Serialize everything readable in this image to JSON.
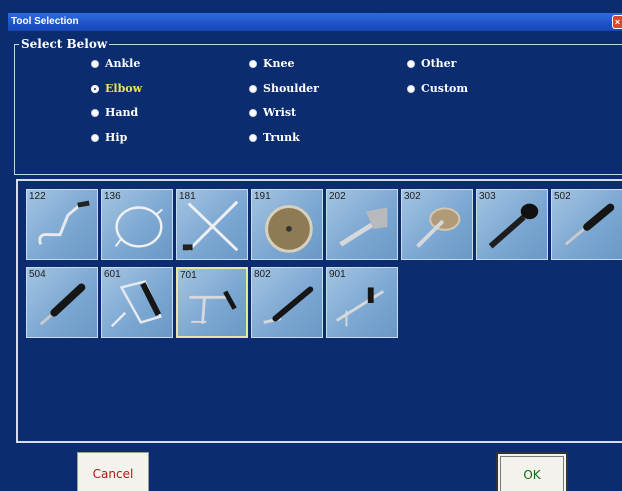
{
  "window": {
    "title": "Tool Selection",
    "close_glyph": "×"
  },
  "group": {
    "legend": "Select Below"
  },
  "options": [
    {
      "label": "Ankle",
      "selected": false
    },
    {
      "label": "Elbow",
      "selected": true
    },
    {
      "label": "Hand",
      "selected": false
    },
    {
      "label": "Hip",
      "selected": false
    },
    {
      "label": "Knee",
      "selected": false
    },
    {
      "label": "Shoulder",
      "selected": false
    },
    {
      "label": "Wrist",
      "selected": false
    },
    {
      "label": "Trunk",
      "selected": false
    },
    {
      "label": "Other",
      "selected": false
    },
    {
      "label": "Custom",
      "selected": false
    }
  ],
  "tools": [
    {
      "number": "122",
      "icon": "crank-handle-icon",
      "selected": false
    },
    {
      "number": "136",
      "icon": "ring-wheel-icon",
      "selected": false
    },
    {
      "number": "181",
      "icon": "cross-bars-icon",
      "selected": false
    },
    {
      "number": "191",
      "icon": "disc-icon",
      "selected": false
    },
    {
      "number": "202",
      "icon": "flat-paddle-icon",
      "selected": false
    },
    {
      "number": "302",
      "icon": "round-plate-icon",
      "selected": false
    },
    {
      "number": "303",
      "icon": "knob-handle-icon",
      "selected": false
    },
    {
      "number": "502",
      "icon": "short-handle-icon",
      "selected": false
    },
    {
      "number": "504",
      "icon": "angled-handle-icon",
      "selected": false
    },
    {
      "number": "601",
      "icon": "d-grip-handle-icon",
      "selected": false
    },
    {
      "number": "701",
      "icon": "t-bar-icon",
      "selected": true
    },
    {
      "number": "802",
      "icon": "long-lever-icon",
      "selected": false
    },
    {
      "number": "901",
      "icon": "clamp-bar-icon",
      "selected": false
    }
  ],
  "buttons": {
    "cancel": "Cancel",
    "ok": "OK"
  },
  "colors": {
    "background": "#0b2c6f",
    "titlebar": "#1f52c8",
    "selected_text": "#f4e24c",
    "tile": "#7aa6d1"
  }
}
